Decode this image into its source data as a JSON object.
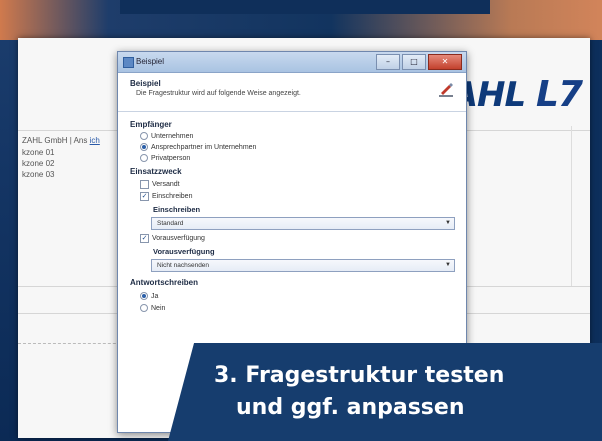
{
  "background": {
    "accent_colors": [
      "#0d2f5c",
      "#d07a4d",
      "#163d6e"
    ]
  },
  "app": {
    "logo_text": "ZAHL",
    "logo_mark": "L7",
    "back_list": {
      "company_line_prefix": "ZAHL GmbH | Ans",
      "company_line_link": "ich",
      "rows": [
        "kzone 01",
        "kzone 02",
        "kzone 03"
      ]
    }
  },
  "dialog": {
    "title": "Beispiel",
    "window_buttons": {
      "minimize": "–",
      "maximize": "□",
      "close": "✕"
    },
    "header": {
      "title": "Beispiel",
      "subtitle": "Die Fragestruktur wird auf folgende Weise angezeigt.",
      "icon": "pen-signature-icon"
    },
    "sections": {
      "empfaenger": {
        "label": "Empfänger",
        "options": [
          {
            "label": "Unternehmen",
            "selected": false
          },
          {
            "label": "Ansprechpartner im Unternehmen",
            "selected": true
          },
          {
            "label": "Privatperson",
            "selected": false
          }
        ]
      },
      "einsatzzweck": {
        "label": "Einsatzzweck",
        "checks": [
          {
            "label": "Versandt",
            "checked": false
          },
          {
            "label": "Einschreiben",
            "checked": true
          }
        ],
        "einschreiben": {
          "label": "Einschreiben",
          "value": "Standard"
        },
        "vorausverfuegung_check": {
          "label": "Vorausverfügung",
          "checked": true
        },
        "vorausverfuegung": {
          "label": "Vorausverfügung",
          "value": "Nicht nachsenden"
        }
      },
      "antwortschreiben": {
        "label": "Antwortschreiben",
        "options": [
          {
            "label": "Ja",
            "selected": true
          },
          {
            "label": "Nein",
            "selected": false
          }
        ]
      }
    }
  },
  "banner": {
    "line1": "3. Fragestruktur testen",
    "line2": "und ggf. anpassen"
  }
}
